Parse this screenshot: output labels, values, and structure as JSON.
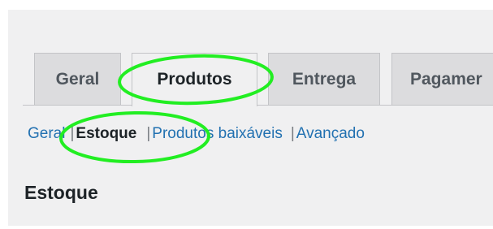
{
  "tabs": [
    {
      "label": "Geral",
      "active": false
    },
    {
      "label": "Produtos",
      "active": true
    },
    {
      "label": "Entrega",
      "active": false
    },
    {
      "label": "Pagamer",
      "active": false
    }
  ],
  "subnav": {
    "items": [
      {
        "label": "Geral",
        "current": false
      },
      {
        "label": "Estoque",
        "current": true
      },
      {
        "label": "Produtos baixáveis",
        "current": false
      },
      {
        "label": "Avançado",
        "current": false
      }
    ],
    "separator": "|"
  },
  "section": {
    "title": "Estoque"
  },
  "colors": {
    "link": "#2271b1",
    "annotation_stroke": "#22ee22",
    "page_background": "#f0f0f1"
  }
}
